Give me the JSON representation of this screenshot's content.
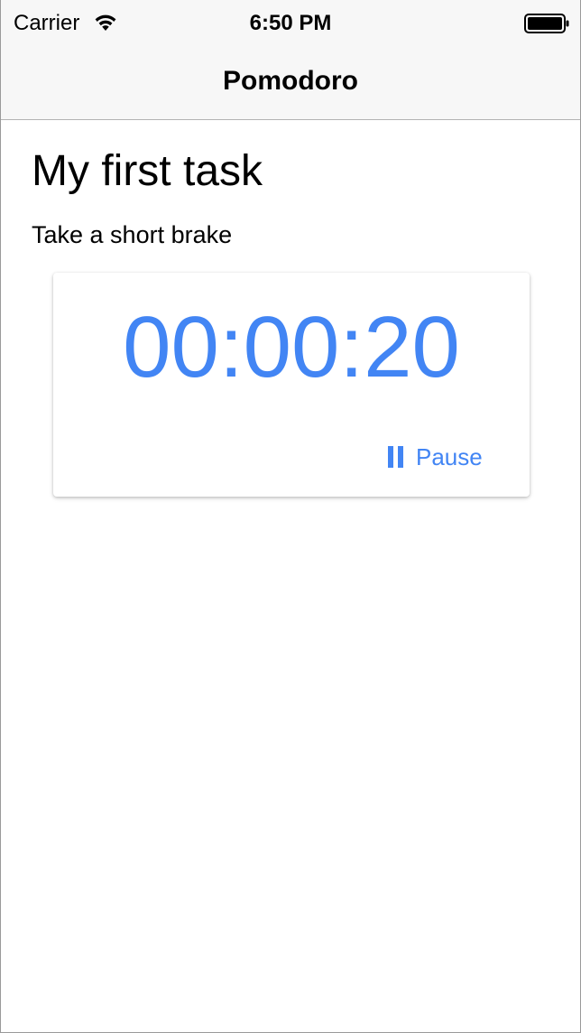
{
  "status_bar": {
    "carrier": "Carrier",
    "time": "6:50 PM",
    "wifi_icon": "wifi-icon",
    "battery_icon": "battery-full-icon"
  },
  "nav": {
    "title": "Pomodoro"
  },
  "task": {
    "title": "My first task",
    "subtitle": "Take a short brake"
  },
  "timer": {
    "display": "00:00:20",
    "pause_label": "Pause",
    "pause_icon": "pause-icon"
  },
  "colors": {
    "accent": "#4285f4",
    "nav_background": "#f7f7f7",
    "text": "#000000"
  }
}
